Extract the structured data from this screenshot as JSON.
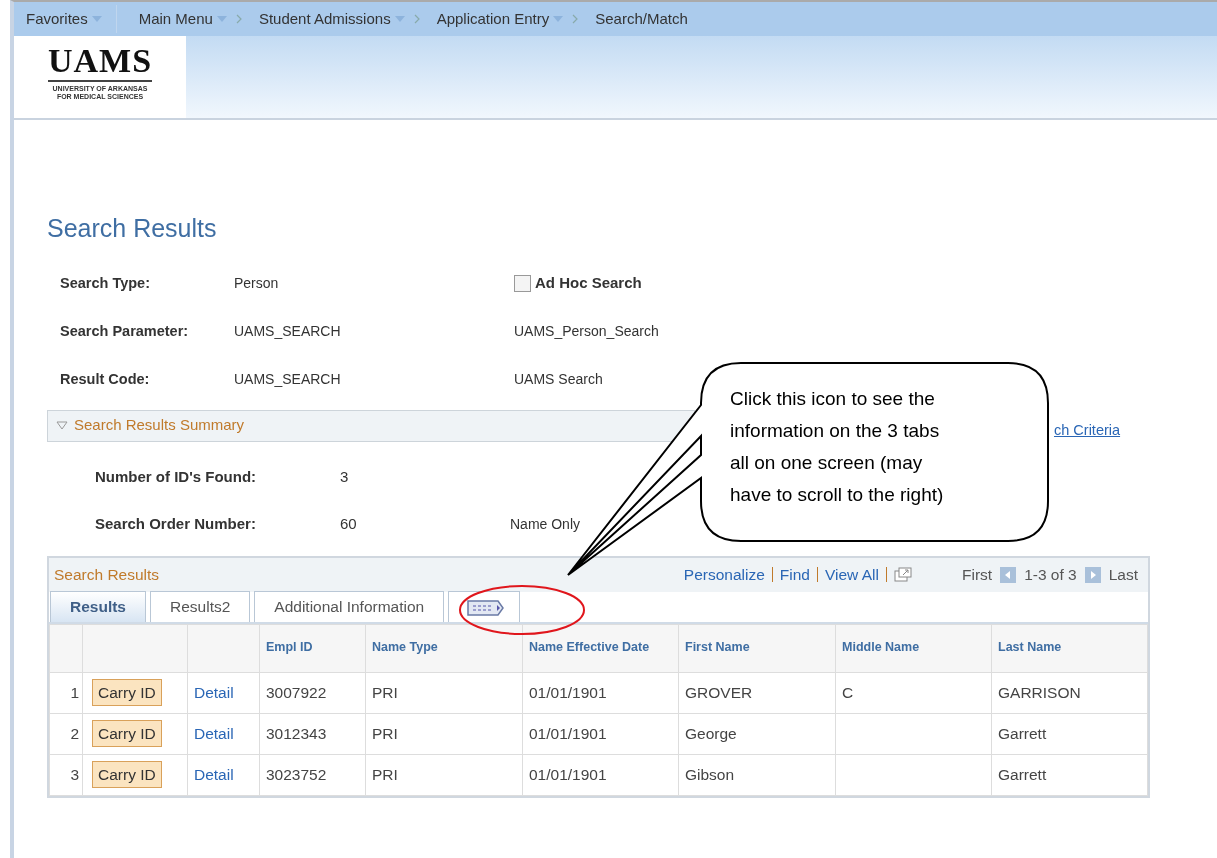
{
  "nav": {
    "items": [
      {
        "label": "Favorites",
        "dropdown": true,
        "chevron_before": false
      },
      {
        "label": "Main Menu",
        "dropdown": true,
        "chevron_before": false
      },
      {
        "label": "Student Admissions",
        "dropdown": true,
        "chevron_before": true
      },
      {
        "label": "Application Entry",
        "dropdown": true,
        "chevron_before": true
      },
      {
        "label": "Search/Match",
        "dropdown": false,
        "chevron_before": true
      }
    ]
  },
  "logo": {
    "mark": "UAMS",
    "subtitle_lines": [
      "UNIVERSITY OF ARKANSAS",
      "FOR MEDICAL SCIENCES"
    ]
  },
  "page_title": "Search Results",
  "fields": [
    {
      "label": "Search Type:",
      "value": "Person",
      "extra": {
        "kind": "checkbox",
        "label": "Ad Hoc Search",
        "checked": false
      }
    },
    {
      "label": "Search Parameter:",
      "value": "UAMS_SEARCH",
      "extra": {
        "kind": "text",
        "text": "UAMS_Person_Search"
      }
    },
    {
      "label": "Result Code:",
      "value": "UAMS_SEARCH",
      "extra": {
        "kind": "text",
        "text": "UAMS Search"
      }
    }
  ],
  "summary": {
    "title": "Search Results Summary",
    "expanded": true,
    "link": "ch Criteria",
    "fields": [
      {
        "label": "Number of ID's Found:",
        "value": "3"
      },
      {
        "label": "Search Order Number:",
        "value": "60",
        "note": "Name Only"
      }
    ]
  },
  "grid": {
    "title": "Search Results",
    "links": [
      "Personalize",
      "Find",
      "View All"
    ],
    "pager": {
      "first": "First",
      "range": "1-3 of 3",
      "last": "Last"
    },
    "tabs": [
      {
        "label": "Results",
        "selected": true
      },
      {
        "label": "Results2",
        "selected": false
      },
      {
        "label": "Additional Information",
        "selected": false
      }
    ],
    "columns": [
      "Empl ID",
      "Name Type",
      "Name Effective Date",
      "First Name",
      "Middle Name",
      "Last Name"
    ],
    "rows": [
      {
        "number": "1",
        "button": "Carry ID",
        "link": "Detail",
        "cells": [
          "3007922",
          "PRI",
          "01/01/1901",
          "GROVER",
          "C",
          "GARRISON"
        ]
      },
      {
        "number": "2",
        "button": "Carry ID",
        "link": "Detail",
        "cells": [
          "3012343",
          "PRI",
          "01/01/1901",
          "George",
          null,
          "Garrett"
        ]
      },
      {
        "number": "3",
        "button": "Carry ID",
        "link": "Detail",
        "cells": [
          "3023752",
          "PRI",
          "01/01/1901",
          "Gibson",
          null,
          "Garrett"
        ]
      }
    ]
  },
  "callout": {
    "lines": [
      "Click this icon to see the",
      "information on the 3 tabs",
      "all on one screen (may",
      "have to scroll to the right)"
    ]
  }
}
